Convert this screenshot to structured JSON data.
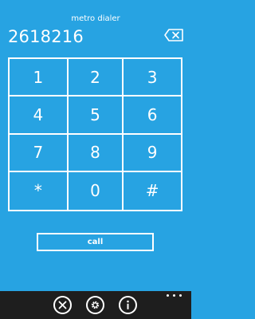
{
  "app": {
    "title": "metro dialer"
  },
  "display": {
    "number": "2618216"
  },
  "keypad": {
    "keys": [
      "1",
      "2",
      "3",
      "4",
      "5",
      "6",
      "7",
      "8",
      "9",
      "*",
      "0",
      "#"
    ]
  },
  "call_button": {
    "label": "call"
  },
  "app_bar": {
    "buttons": [
      "close-icon",
      "settings-icon",
      "info-icon"
    ],
    "more": "more-dots-icon"
  },
  "colors": {
    "background": "#27a3e2",
    "app_bar": "#1e1e1e",
    "foreground": "#ffffff"
  }
}
